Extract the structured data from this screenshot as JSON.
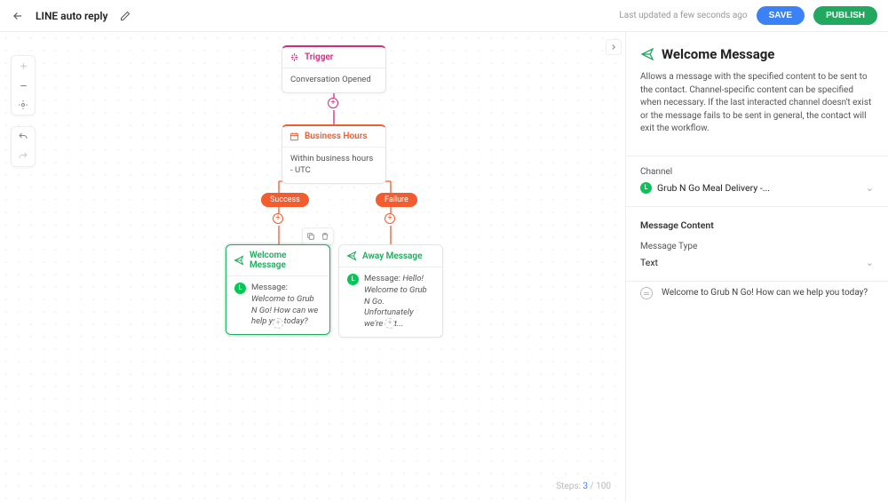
{
  "header": {
    "title": "LINE auto reply",
    "last_updated": "Last updated a few seconds ago",
    "save_label": "SAVE",
    "publish_label": "PUBLISH"
  },
  "canvas": {
    "steps_label": "Steps:",
    "steps_current": "3",
    "steps_max": "100",
    "nodes": {
      "trigger": {
        "title": "Trigger",
        "body": "Conversation Opened"
      },
      "hours": {
        "title": "Business Hours",
        "body": "Within business hours - UTC"
      },
      "welcome": {
        "title": "Welcome Message",
        "msg_label": "Message:",
        "msg_text": "Welcome to Grub N Go! How can we help  you today?"
      },
      "away": {
        "title": "Away Message",
        "msg_label": "Message:",
        "msg_text": "Hello! Welcome to Grub N Go. Unfortunately we're not..."
      }
    },
    "pills": {
      "success": "Success",
      "failure": "Failure"
    }
  },
  "panel": {
    "title": "Welcome Message",
    "description": "Allows a message with the specified content to be sent to the contact. Channel-specific content can be specified when necessary. If the last interacted channel doesn't exist or the message fails to be sent in general, the contact will exit the workflow.",
    "channel_label": "Channel",
    "channel_value": "Grub N Go Meal Delivery -...",
    "content_label": "Message Content",
    "type_label": "Message Type",
    "type_value": "Text",
    "preview_text": "Welcome to Grub N Go! How can we help you today?"
  }
}
